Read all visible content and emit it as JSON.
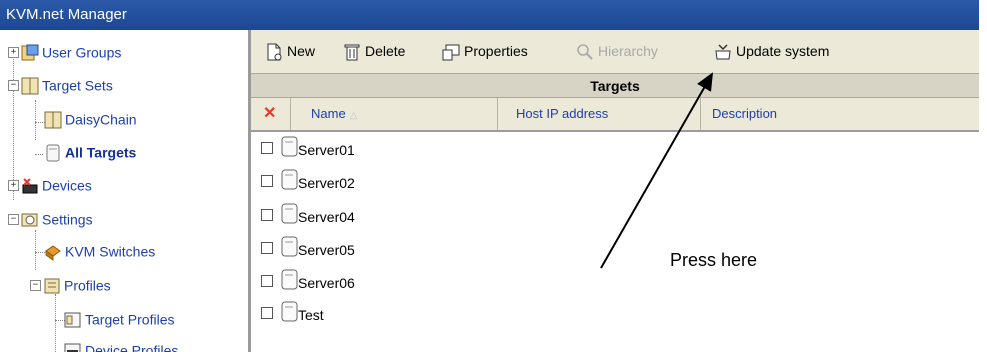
{
  "window": {
    "title": "KVM.net Manager"
  },
  "tree": {
    "items": [
      {
        "label": "User Groups"
      },
      {
        "label": "Target Sets"
      },
      {
        "label": "DaisyChain"
      },
      {
        "label": "All Targets"
      },
      {
        "label": "Devices"
      },
      {
        "label": "Settings"
      },
      {
        "label": "KVM Switches"
      },
      {
        "label": "Profiles"
      },
      {
        "label": "Target Profiles"
      },
      {
        "label": "Device Profiles"
      }
    ]
  },
  "toolbar": {
    "new_label": "New",
    "delete_label": "Delete",
    "properties_label": "Properties",
    "hierarchy_label": "Hierarchy",
    "update_label": "Update system"
  },
  "table": {
    "caption": "Targets",
    "columns": [
      "Name",
      "Host IP address",
      "Description"
    ],
    "rows": [
      {
        "name": "Server01"
      },
      {
        "name": "Server02"
      },
      {
        "name": "Server04"
      },
      {
        "name": "Server05"
      },
      {
        "name": "Server06"
      },
      {
        "name": "Test"
      }
    ]
  },
  "annotation": {
    "text": "Press here"
  },
  "colors": {
    "title_bar": "#1c4794",
    "tree_link": "#1b3fb0",
    "header_text": "#1b3fb0",
    "delete_x": "#e23b2a"
  }
}
